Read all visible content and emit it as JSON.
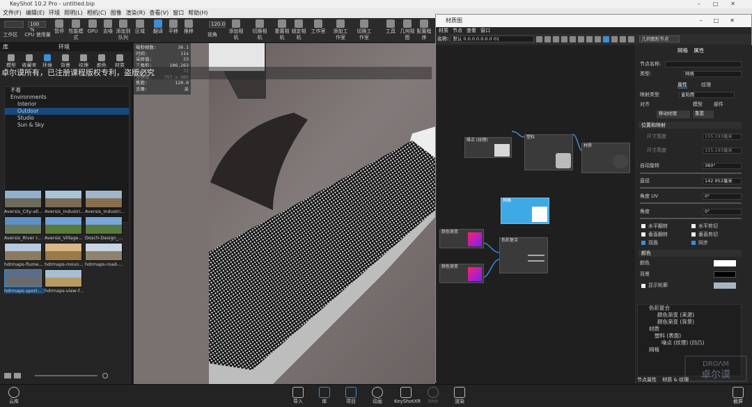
{
  "app": {
    "title": "KeyShot 10.2 Pro  -  untitled.bip"
  },
  "menubar": [
    "文件(F)",
    "编辑(E)",
    "环境",
    "照明(L)",
    "相机(C)",
    "图像",
    "渲染(R)",
    "查看(V)",
    "窗口",
    "帮助(H)"
  ],
  "toolbar": {
    "zoom_value": "100 %",
    "cpu_value": "120.0",
    "buttons": [
      "工作区",
      "CPU 使用量",
      "暂停",
      "性能模式",
      "GPU",
      "去噪",
      "添加到队列",
      "区域",
      "翻译",
      "平移",
      "推移",
      "视角",
      "添加相机",
      "切换相机",
      "重置相机",
      "锁定相机",
      "工作室",
      "添加工作室",
      "切换工作室",
      "工具",
      "几何视图",
      "配置程序"
    ]
  },
  "library": {
    "panel_title": "库",
    "section_title": "环境",
    "tabs": [
      "模型",
      "收藏夹",
      "环境",
      "背景",
      "纹理",
      "颜色",
      "材质"
    ],
    "active_tab": "环境",
    "tree": [
      {
        "label": "不着",
        "selected": false
      },
      {
        "label": "Environments",
        "selected": false
      },
      {
        "label": "Interior",
        "selected": false
      },
      {
        "label": "Outdoor",
        "selected": true
      },
      {
        "label": "Studio",
        "selected": false
      },
      {
        "label": "Sun & Sky",
        "selected": false
      }
    ],
    "thumbnails": [
      "Aversis_City-all...",
      "Aversis_Industri...",
      "Aversis_Industri...",
      "Aversis_River r...",
      "Aversis_Village...",
      "Dosch-Design_...",
      "hdrmaps-flume...",
      "hdrmaps-moun...",
      "hdrmaps-road-...",
      "hdrmaps-sport...",
      "hdrmaps-view-f..."
    ]
  },
  "stats": [
    {
      "k": "每秒帧数:",
      "v": "36.1"
    },
    {
      "k": "时间:",
      "v": "11s"
    },
    {
      "k": "采样值:",
      "v": "23"
    },
    {
      "k": "三角形:",
      "v": "106,263"
    },
    {
      "k": "NURBS:",
      "v": "72"
    },
    {
      "k": "分辨率:",
      "v": "757 x 985"
    },
    {
      "k": "焦距:",
      "v": "120.0"
    },
    {
      "k": "去噪:",
      "v": "关"
    }
  ],
  "watermark": "卓尔谟所有，已注册课程版权专利，盗版必究",
  "material_window": {
    "title": "材质图",
    "menu": [
      "材质",
      "节点",
      "查看",
      "窗口"
    ],
    "name_label": "名称:",
    "name_value": "默认 0.0.0.0.0.0.0 01",
    "node_link_button": "几何图形节点",
    "nodes": [
      {
        "label": "噪点 (纹理)"
      },
      {
        "label": "塑料"
      },
      {
        "label": "材质"
      },
      {
        "label": "网格"
      },
      {
        "label": "颜色渐变"
      },
      {
        "label": "颜色渐变"
      },
      {
        "label": "色彩复合"
      }
    ]
  },
  "properties": {
    "tabs": [
      "网格",
      "属性"
    ],
    "node_name_label": "节点名称:",
    "type_label": "类型:",
    "type_value": "网格",
    "sub_tabs": [
      "属性",
      "纹理"
    ],
    "mapping_label": "映射类型",
    "mapping_value": "盒贴图",
    "alignment_label": "对齐",
    "alignment_options": [
      "模型",
      "部件"
    ],
    "move_texture_button": "移动纹理",
    "reset_button": "重置",
    "section_position": "位置和映射",
    "size_x_label": "尺寸宽度",
    "size_x_value": "155.193毫米",
    "size_y_label": "尺寸高度",
    "size_y_value": "155.193毫米",
    "auto_rotate_label": "自动旋转",
    "auto_rotate_value": "360°",
    "diameter_label": "直径",
    "diameter_value": "142.952毫米",
    "angle_uv_label": "角度 UV",
    "angle_uv_value": "0°",
    "angle_label": "角度",
    "angle_value": "0°",
    "checks": [
      "水平翻转",
      "水平剪切",
      "垂直翻转",
      "垂直剪切",
      "双面",
      "同步"
    ],
    "section_color": "颜色",
    "color_label": "颜色",
    "background_label": "背景",
    "show_texture_label": "显示轮廓",
    "bottom_tabs": [
      "节点属性",
      "材质 & 纹理"
    ],
    "tree": [
      "色彩复合",
      "颜色渐变 (来源)",
      "颜色渐变 (背景)",
      "材质",
      "塑料 (表面)",
      "噪点 (纹理) (凹凸)",
      "网格"
    ]
  },
  "bottom_bar": {
    "left_button": "云库",
    "center_buttons": [
      "导入",
      "库",
      "项目",
      "动画",
      "KeyShotXR",
      "Web",
      "渲染"
    ],
    "active_button": "库",
    "right_button": "截屏"
  },
  "colors": {
    "accent": "#3a8fd6",
    "selected_row": "#174a7c",
    "gradient_a": "#ff1f6e",
    "gradient_b": "#7a1fff",
    "node_highlight": "#3fa9e5"
  }
}
